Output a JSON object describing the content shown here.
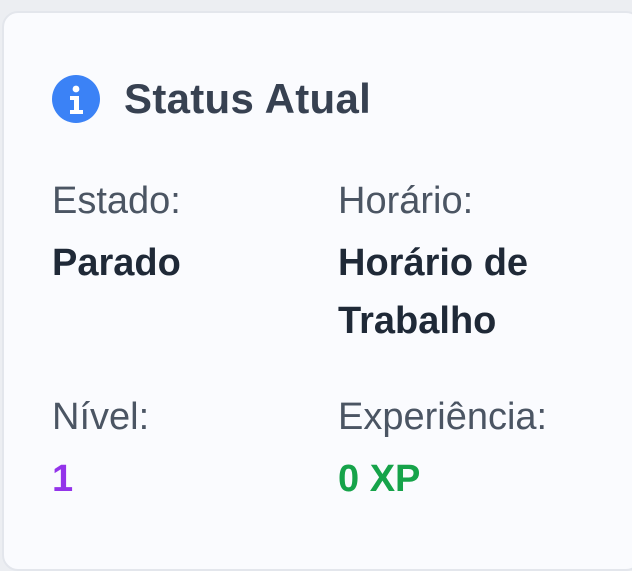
{
  "card": {
    "title": "Status Atual",
    "icon": "info-icon",
    "accent_color": "#3b82f6"
  },
  "fields": {
    "estado": {
      "label": "Estado:",
      "value": "Parado",
      "color": "#1f2937"
    },
    "horario": {
      "label": "Horário:",
      "value": "Horário de Trabalho",
      "color": "#1f2937"
    },
    "nivel": {
      "label": "Nível:",
      "value": "1",
      "color": "#9333ea"
    },
    "experiencia": {
      "label": "Experiência:",
      "value": "0 XP",
      "color": "#16a34a"
    }
  }
}
